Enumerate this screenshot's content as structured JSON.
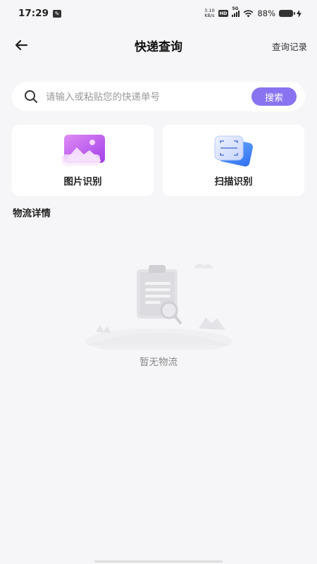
{
  "status": {
    "time": "17:29",
    "net_speed_value": "3.10",
    "net_speed_unit": "KB/s",
    "hd": "HD",
    "network": "5G",
    "battery": "88%"
  },
  "header": {
    "title": "快递查询",
    "history_label": "查询记录"
  },
  "search": {
    "placeholder": "请输入或粘贴您的快递单号",
    "value": "",
    "button_label": "搜索"
  },
  "cards": [
    {
      "label": "图片识别",
      "icon": "image-icon",
      "accent": "#c05cf0"
    },
    {
      "label": "扫描识别",
      "icon": "scan-icon",
      "accent": "#4a8ef5"
    }
  ],
  "section": {
    "title": "物流详情"
  },
  "empty": {
    "text": "暂无物流"
  },
  "colors": {
    "accent": "#8a73f0",
    "background": "#f6f6f8"
  }
}
